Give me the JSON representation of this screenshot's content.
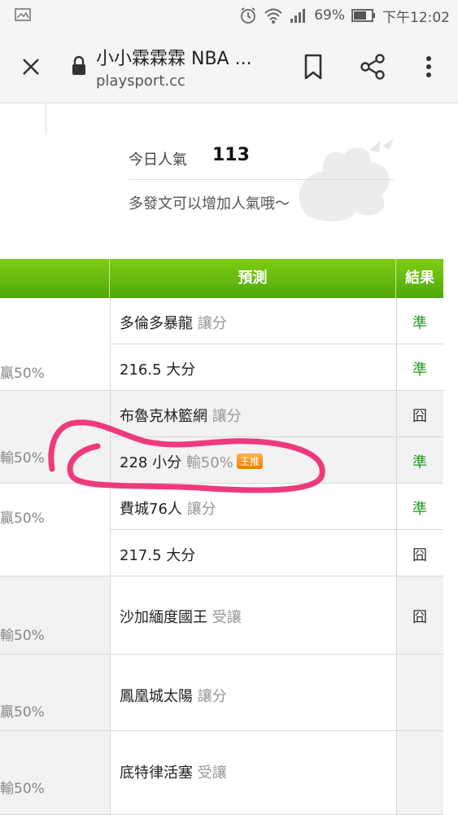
{
  "status_bar": {
    "battery": "69%",
    "time": "下午12:02",
    "icons": [
      "image-icon",
      "alarm-icon",
      "wifi-icon",
      "signal-icon",
      "battery-icon"
    ]
  },
  "browser": {
    "title": "小小霖霖霖 NBA ...",
    "url": "playsport.cc",
    "icons": [
      "close-icon",
      "lock-icon",
      "bookmark-icon",
      "share-icon",
      "more-icon"
    ]
  },
  "popularity": {
    "label": "今日人氣",
    "value": "113",
    "hint": "多發文可以增加人氣哦～"
  },
  "table": {
    "header_predict": "預測",
    "header_result": "結果",
    "header_color": "#5cb20d",
    "groups": [
      {
        "left": "贏50%",
        "rows": [
          {
            "team": "多倫多暴龍",
            "sub": "讓分",
            "result": "準",
            "status": "hit"
          },
          {
            "team": "216.5 大分",
            "sub": "",
            "result": "準",
            "status": "hit"
          }
        ]
      },
      {
        "left": "輸50%",
        "rows": [
          {
            "team": "布魯克林籃網",
            "sub": "讓分",
            "result": "囧",
            "status": "miss"
          },
          {
            "team": "228 小分",
            "sub": "輸50%",
            "badge": "王推",
            "result": "準",
            "status": "hit"
          }
        ]
      },
      {
        "left": "贏50%",
        "rows": [
          {
            "team": "費城76人",
            "sub": "讓分",
            "result": "準",
            "status": "hit"
          },
          {
            "team": "217.5 大分",
            "sub": "",
            "result": "囧",
            "status": "miss"
          }
        ]
      },
      {
        "left": "輸50%",
        "rows": [
          {
            "team": "沙加緬度國王",
            "sub": "受讓",
            "result": "囧",
            "status": "miss"
          }
        ]
      },
      {
        "left": "贏50%",
        "rows": [
          {
            "team": "鳳凰城太陽",
            "sub": "讓分",
            "result": "",
            "status": "none"
          }
        ]
      },
      {
        "left": "輸50%",
        "rows": [
          {
            "team": "底特律活塞",
            "sub": "受讓",
            "result": "",
            "status": "none"
          }
        ]
      }
    ]
  },
  "annotation_color": "#ee3a7c"
}
